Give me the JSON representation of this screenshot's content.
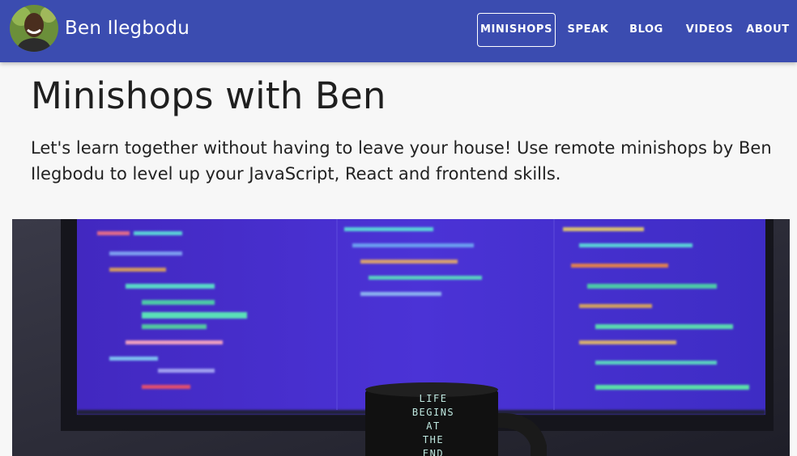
{
  "site": {
    "name": "Ben Ilegbodu"
  },
  "nav": {
    "items": [
      {
        "label": "MINISHOPS",
        "active": true
      },
      {
        "label": "SPEAK",
        "active": false
      },
      {
        "label": "BLOG",
        "active": false
      },
      {
        "label": "VIDEOS",
        "active": false
      },
      {
        "label": "ABOUT",
        "active": false
      }
    ]
  },
  "main": {
    "title": "Minishops with Ben",
    "intro": "Let's learn together without having to leave your house! Use remote minishops by Ben Ilegbodu to level up your JavaScript, React and frontend skills.",
    "hero": {
      "mug_text": [
        "LIFE",
        "BEGINS",
        "AT",
        "THE",
        "END"
      ]
    }
  },
  "colors": {
    "appbar": "#3b4cb0",
    "background": "#f7f7f7",
    "screen": "#4a2fc8"
  }
}
